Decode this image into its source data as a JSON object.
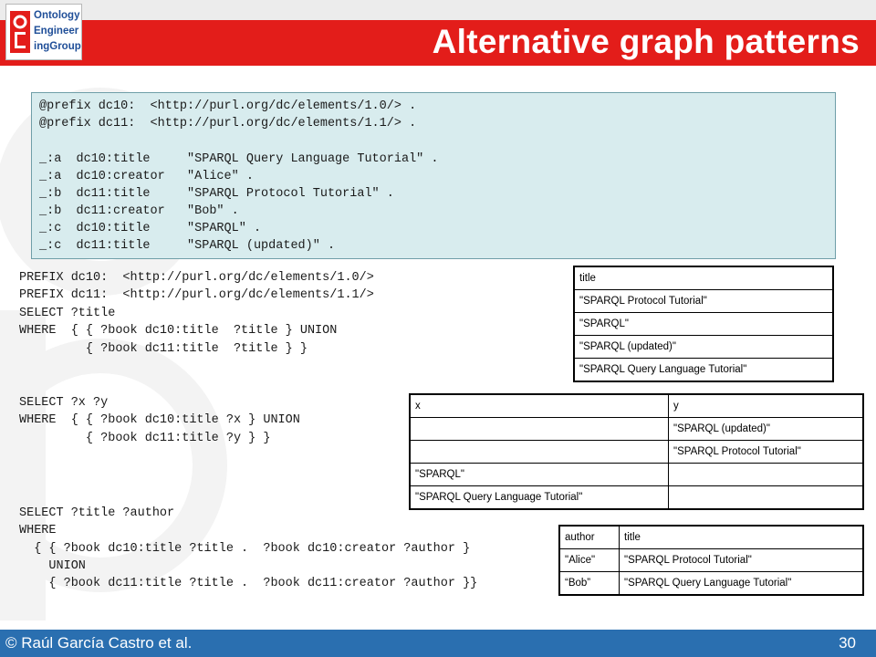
{
  "header": {
    "title": "Alternative graph patterns",
    "logo_lines": [
      "Ontology",
      "Engineer",
      "ingGroup"
    ]
  },
  "data_box": {
    "lines": [
      "@prefix dc10:  <http://purl.org/dc/elements/1.0/> .",
      "@prefix dc11:  <http://purl.org/dc/elements/1.1/> .",
      "",
      "_:a  dc10:title     \"SPARQL Query Language Tutorial\" .",
      "_:a  dc10:creator   \"Alice\" .",
      "_:b  dc11:title     \"SPARQL Protocol Tutorial\" .",
      "_:b  dc11:creator   \"Bob\" .",
      "_:c  dc10:title     \"SPARQL\" .",
      "_:c  dc11:title     \"SPARQL (updated)\" ."
    ]
  },
  "query1": {
    "lines": [
      "PREFIX dc10:  <http://purl.org/dc/elements/1.0/>",
      "PREFIX dc11:  <http://purl.org/dc/elements/1.1/>",
      "SELECT ?title",
      "WHERE  { { ?book dc10:title  ?title } UNION",
      "         { ?book dc11:title  ?title } }"
    ]
  },
  "query2": {
    "lines": [
      "SELECT ?x ?y",
      "WHERE  { { ?book dc10:title ?x } UNION",
      "         { ?book dc11:title ?y } }"
    ]
  },
  "query3": {
    "lines": [
      "SELECT ?title ?author",
      "WHERE",
      "  { { ?book dc10:title ?title .  ?book dc10:creator ?author }",
      "    UNION",
      "    { ?book dc11:title ?title .  ?book dc11:creator ?author }}"
    ]
  },
  "table1": {
    "header": "title",
    "rows": [
      "\"SPARQL Protocol Tutorial\"",
      "\"SPARQL\"",
      "\"SPARQL (updated)\"",
      "\"SPARQL Query Language Tutorial\""
    ]
  },
  "table2": {
    "headers": [
      "x",
      "y"
    ],
    "rows": [
      [
        "",
        "\"SPARQL (updated)\""
      ],
      [
        "",
        "\"SPARQL Protocol Tutorial\""
      ],
      [
        "\"SPARQL\"",
        ""
      ],
      [
        "\"SPARQL Query Language Tutorial\"",
        ""
      ]
    ]
  },
  "table3": {
    "headers": [
      "author",
      "title"
    ],
    "rows": [
      [
        "\"Alice\"",
        "\"SPARQL Protocol Tutorial\""
      ],
      [
        "“Bob”",
        "\"SPARQL Query Language Tutorial\""
      ]
    ]
  },
  "footer": {
    "copyright": "© Raúl García Castro et al.",
    "page_number": "30"
  },
  "colors": {
    "header_red": "#e31d1a",
    "footer_blue": "#2a6fb0",
    "data_box_bg": "#d8ecee"
  }
}
